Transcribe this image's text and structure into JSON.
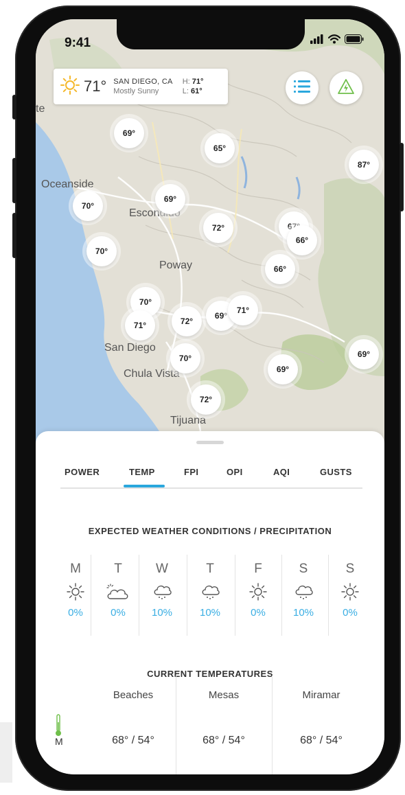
{
  "status_bar": {
    "time": "9:41"
  },
  "weather_card": {
    "temp": "71°",
    "city": "SAN DIEGO, CA",
    "condition": "Mostly Sunny",
    "high_label": "H:",
    "high": "71°",
    "low_label": "L:",
    "low": "61°"
  },
  "map_buttons": {
    "list_icon": "list-icon",
    "alert_icon": "power-alert-icon"
  },
  "places": [
    "Oceanside",
    "Escondido",
    "Poway",
    "San Diego",
    "Chula Vista",
    "Tijuana",
    "te"
  ],
  "markers": [
    "69°",
    "65°",
    "87°",
    "70°",
    "69°",
    "72°",
    "67°",
    "66°",
    "70°",
    "66°",
    "70°",
    "71°",
    "72°",
    "69°",
    "71°",
    "70°",
    "69°",
    "69°",
    "72°"
  ],
  "tabs": [
    "POWER",
    "TEMP",
    "FPI",
    "OPI",
    "AQI",
    "GUSTS"
  ],
  "active_tab": "TEMP",
  "forecast": {
    "title": "EXPECTED WEATHER CONDITIONS / PRECIPITATION",
    "days": [
      {
        "day": "M",
        "icon": "sun-icon",
        "precip": "0%"
      },
      {
        "day": "T",
        "icon": "cloud-icon",
        "precip": "0%"
      },
      {
        "day": "W",
        "icon": "rain-cloud-icon",
        "precip": "10%"
      },
      {
        "day": "T",
        "icon": "rain-cloud-icon",
        "precip": "10%"
      },
      {
        "day": "F",
        "icon": "sun-icon",
        "precip": "0%"
      },
      {
        "day": "S",
        "icon": "rain-cloud-icon",
        "precip": "10%"
      },
      {
        "day": "S",
        "icon": "sun-icon",
        "precip": "0%"
      }
    ]
  },
  "current_temps": {
    "title": "CURRENT TEMPERATURES",
    "icon": "thermometer-icon",
    "columns": [
      "Beaches",
      "Mesas",
      "Miramar"
    ],
    "row_label": "M",
    "values": [
      "68° / 54°",
      "68° / 54°",
      "68° / 54°"
    ]
  },
  "colors": {
    "accent": "#2aa7dd",
    "precip": "#3aaee3",
    "alert_green": "#6fbf4a",
    "sun_yellow": "#f4b82a"
  }
}
